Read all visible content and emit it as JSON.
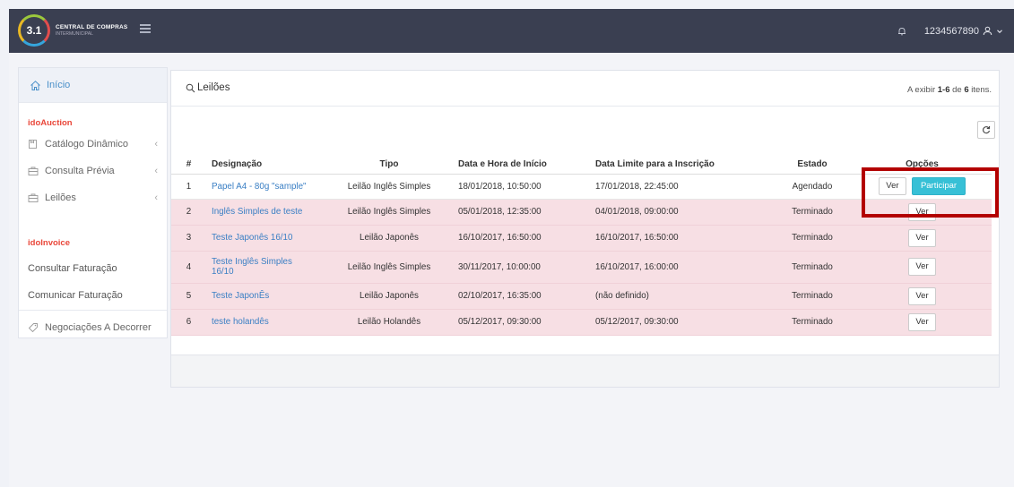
{
  "header": {
    "logo_number": "3.1",
    "logo_title": "CENTRAL DE COMPRAS",
    "logo_subtitle": "INTERMUNICIPAL",
    "user_id": "1234567890"
  },
  "sidebar": {
    "home": "Início",
    "section_auction": "idoAuction",
    "items_auction": [
      {
        "label": "Catálogo Dinâmico",
        "icon": "catalog-icon"
      },
      {
        "label": "Consulta Prévia",
        "icon": "briefcase-icon"
      },
      {
        "label": "Leilões",
        "icon": "briefcase-icon"
      }
    ],
    "section_invoice": "idoInvoice",
    "link_consultar": "Consultar Faturação",
    "link_comunicar": "Comunicar Faturação",
    "negociacoes": "Negociações A Decorrer"
  },
  "panel": {
    "title": "Leilões",
    "summary_prefix": "A exibir ",
    "summary_range": "1-6",
    "summary_mid": " de ",
    "summary_total": "6",
    "summary_suffix": " itens."
  },
  "table": {
    "headers": [
      "#",
      "Designação",
      "Tipo",
      "Data e Hora de Início",
      "Data Limite para a Inscrição",
      "Estado",
      "Opções"
    ],
    "btn_ver": "Ver",
    "btn_participar": "Participar",
    "rows": [
      {
        "num": "1",
        "designacao": "Papel A4 - 80g \"sample\"",
        "tipo": "Leilão Inglês Simples",
        "inicio": "18/01/2018, 10:50:00",
        "limite": "17/01/2018, 22:45:00",
        "estado": "Agendado"
      },
      {
        "num": "2",
        "designacao": "Inglês Simples de teste",
        "tipo": "Leilão Inglês Simples",
        "inicio": "05/01/2018, 12:35:00",
        "limite": "04/01/2018, 09:00:00",
        "estado": "Terminado"
      },
      {
        "num": "3",
        "designacao": "Teste Japonês 16/10",
        "tipo": "Leilão Japonês",
        "inicio": "16/10/2017, 16:50:00",
        "limite": "16/10/2017, 16:50:00",
        "estado": "Terminado"
      },
      {
        "num": "4",
        "designacao": "Teste Inglês Simples 16/10",
        "tipo": "Leilão Inglês Simples",
        "inicio": "30/11/2017, 10:00:00",
        "limite": "16/10/2017, 16:00:00",
        "estado": "Terminado"
      },
      {
        "num": "5",
        "designacao": "Teste JaponÊs",
        "tipo": "Leilão Japonês",
        "inicio": "02/10/2017, 16:35:00",
        "limite": "(não definido)",
        "estado": "Terminado"
      },
      {
        "num": "6",
        "designacao": "teste holandês",
        "tipo": "Leilão Holandês",
        "inicio": "05/12/2017, 09:30:00",
        "limite": "05/12/2017, 09:30:00",
        "estado": "Terminado"
      }
    ]
  }
}
